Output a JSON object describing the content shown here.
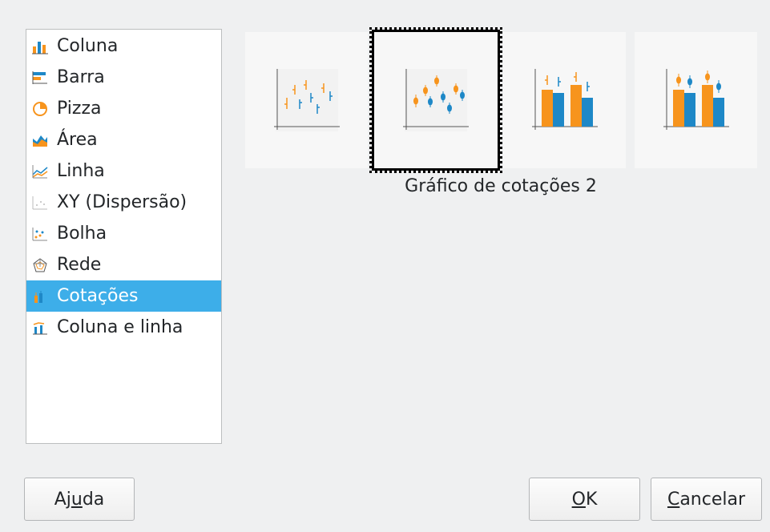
{
  "chart_types": [
    {
      "label": "Coluna",
      "icon": "column-chart-icon"
    },
    {
      "label": "Barra",
      "icon": "bar-chart-icon"
    },
    {
      "label": "Pizza",
      "icon": "pie-chart-icon"
    },
    {
      "label": "Área",
      "icon": "area-chart-icon"
    },
    {
      "label": "Linha",
      "icon": "line-chart-icon"
    },
    {
      "label": "XY (Dispersão)",
      "icon": "scatter-chart-icon"
    },
    {
      "label": "Bolha",
      "icon": "bubble-chart-icon"
    },
    {
      "label": "Rede",
      "icon": "net-chart-icon"
    },
    {
      "label": "Cotações",
      "icon": "stock-chart-icon",
      "selected": true
    },
    {
      "label": "Coluna e linha",
      "icon": "column-line-chart-icon"
    }
  ],
  "variants": [
    {
      "icon": "stock-chart-1-icon"
    },
    {
      "icon": "stock-chart-2-icon",
      "selected": true
    },
    {
      "icon": "stock-chart-3-icon"
    },
    {
      "icon": "stock-chart-4-icon"
    }
  ],
  "selected_variant_caption": "Gráfico de cotações 2",
  "buttons": {
    "help": {
      "before": "Aj",
      "mnemonic": "u",
      "after": "da"
    },
    "ok": {
      "before": "",
      "mnemonic": "O",
      "after": "K"
    },
    "cancel": {
      "before": "",
      "mnemonic": "C",
      "after": "ancelar"
    }
  },
  "colors": {
    "accent": "#3daee9",
    "orange": "#f7941d",
    "blue": "#1e88c7"
  }
}
